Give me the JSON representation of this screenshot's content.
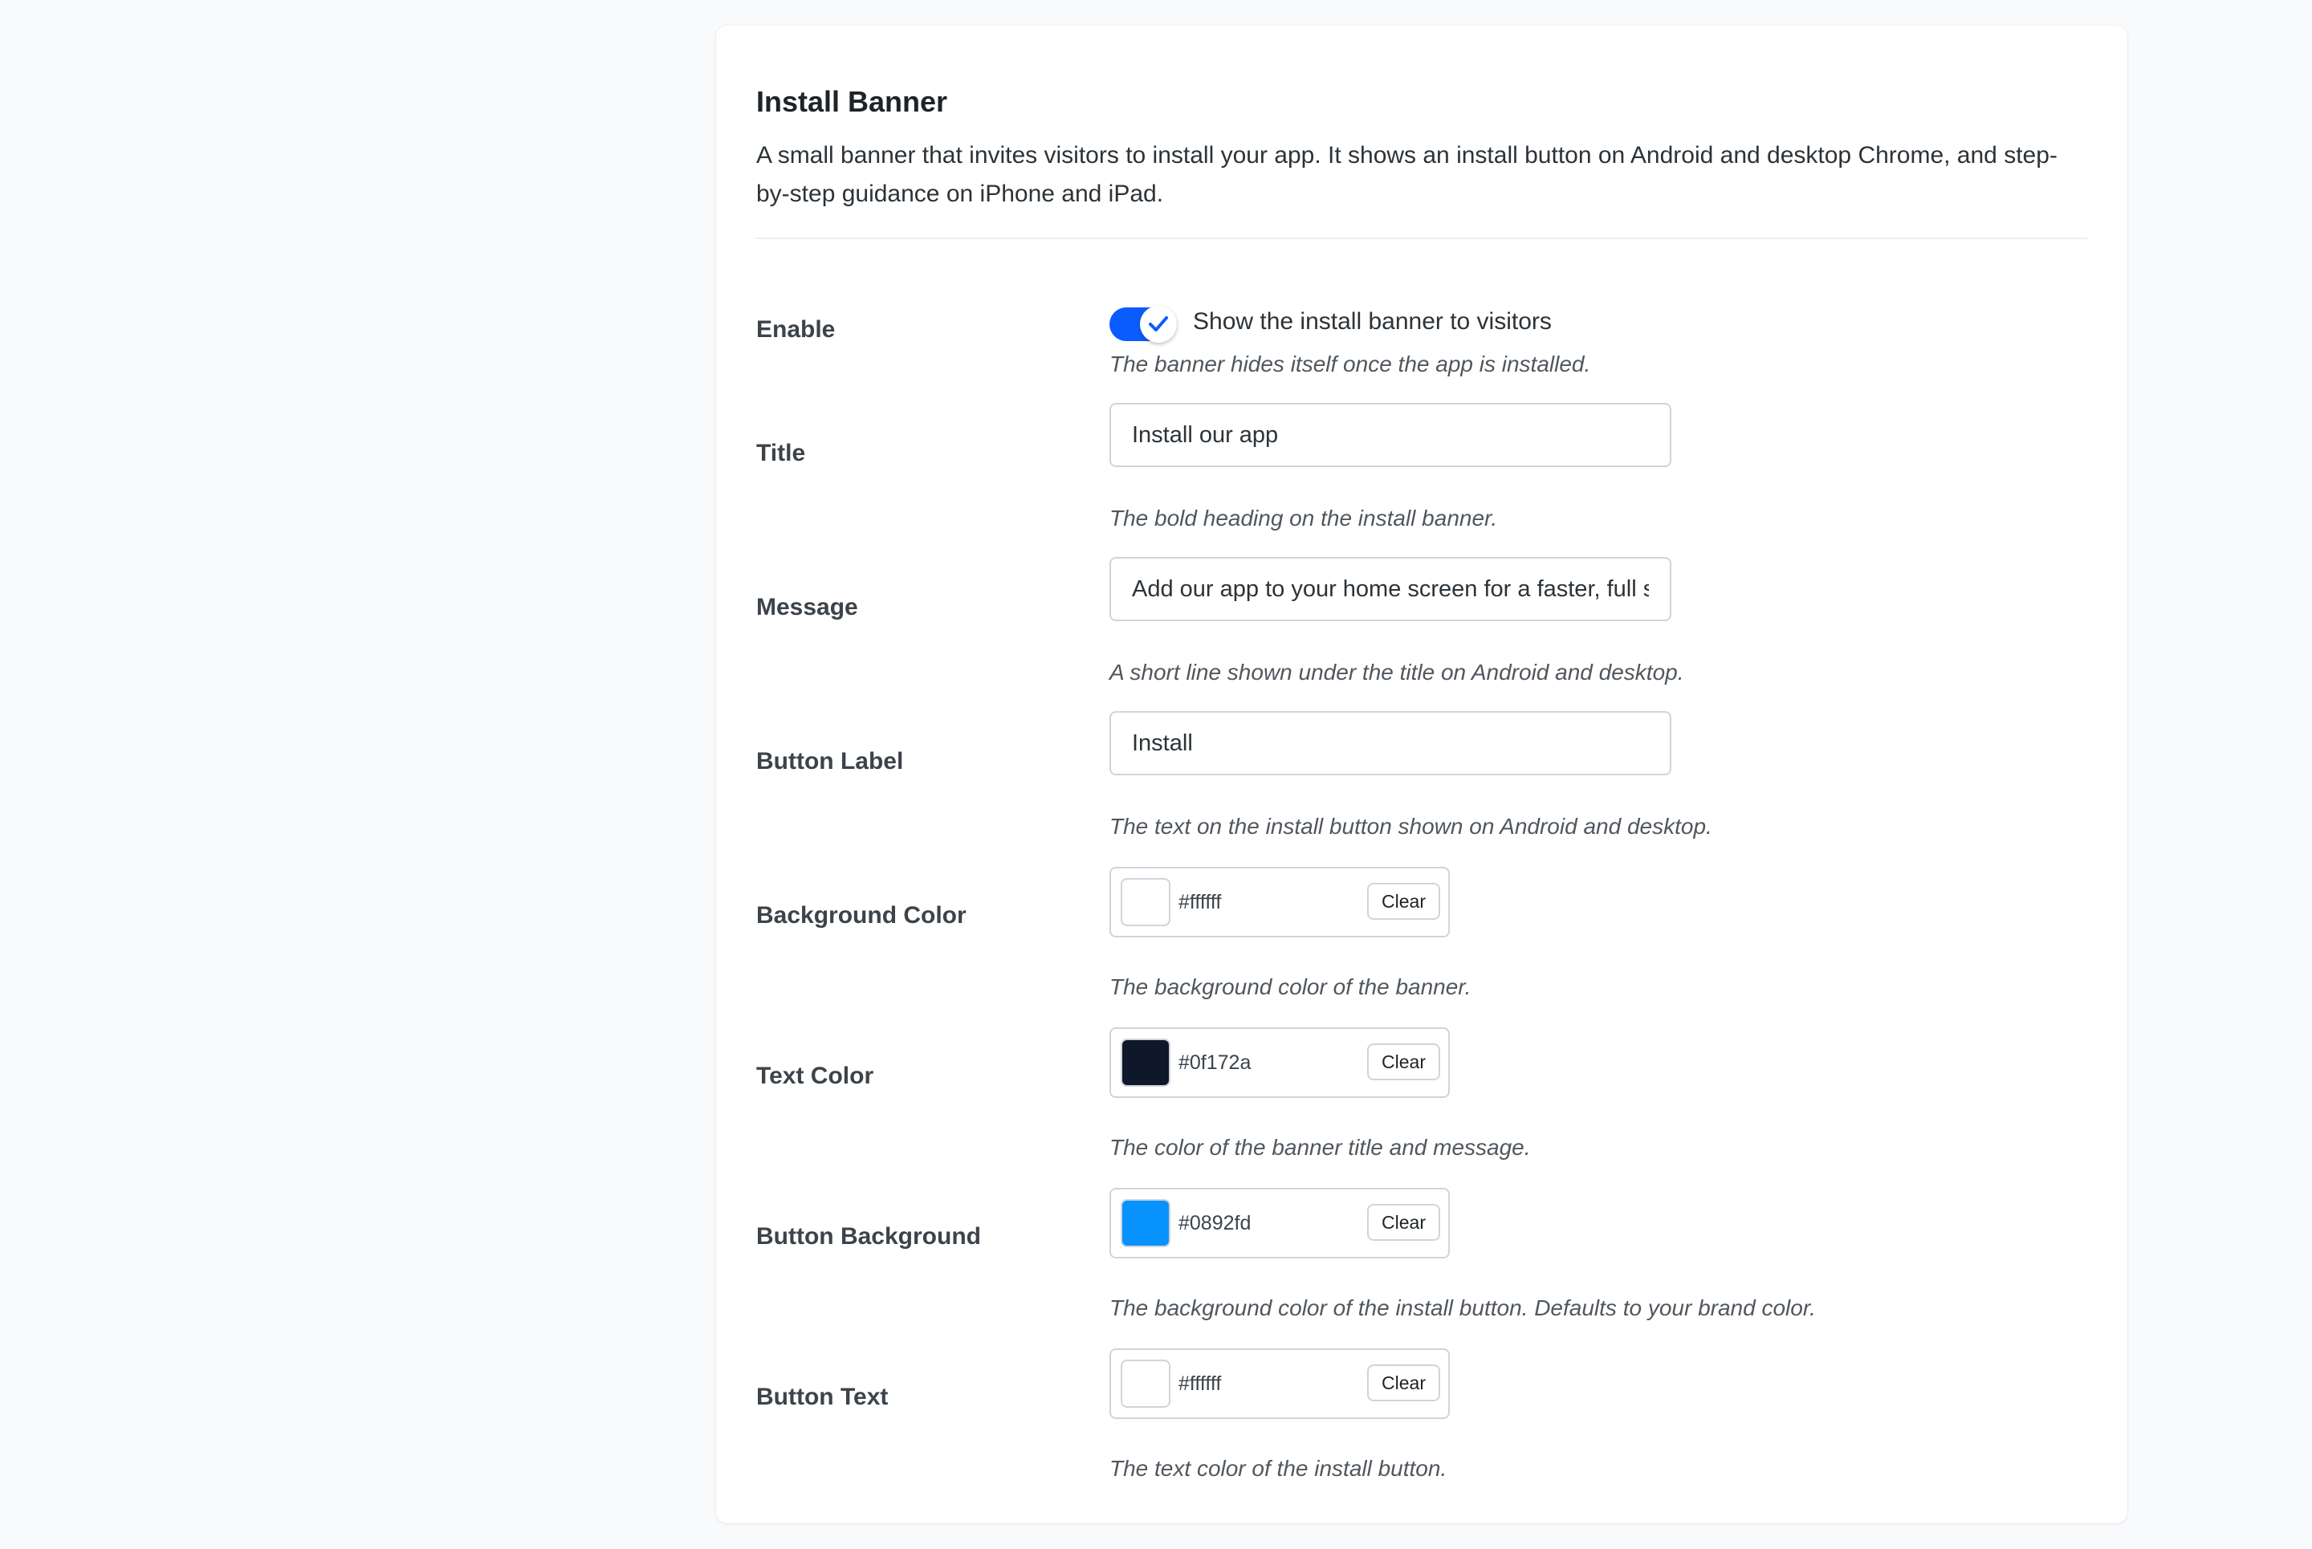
{
  "section": {
    "title": "Install Banner",
    "description": "A small banner that invites visitors to install your app. It shows an install button on Android and desktop Chrome, and step-by-step guidance on iPhone and iPad."
  },
  "enable": {
    "label": "Enable",
    "checked": true,
    "toggle_label": "Show the install banner to visitors",
    "help": "The banner hides itself once the app is installed."
  },
  "title_field": {
    "label": "Title",
    "value": "Install our app",
    "help": "The bold heading on the install banner."
  },
  "message_field": {
    "label": "Message",
    "value": "Add our app to your home screen for a faster, full s",
    "help": "A short line shown under the title on Android and desktop."
  },
  "button_label_field": {
    "label": "Button Label",
    "value": "Install",
    "help": "The text on the install button shown on Android and desktop."
  },
  "background_color": {
    "label": "Background Color",
    "value": "#ffffff",
    "clear_label": "Clear",
    "help": "The background color of the banner."
  },
  "text_color": {
    "label": "Text Color",
    "value": "#0f172a",
    "clear_label": "Clear",
    "help": "The color of the banner title and message."
  },
  "button_background": {
    "label": "Button Background",
    "value": "#0892fd",
    "clear_label": "Clear",
    "help": "The background color of the install button. Defaults to your brand color."
  },
  "button_text": {
    "label": "Button Text",
    "value": "#ffffff",
    "clear_label": "Clear",
    "help": "The text color of the install button."
  },
  "colors": {
    "toggle_on": "#0b5cff",
    "checkmark": "#0b5cff"
  },
  "icons": {
    "toggle_knob": "checkmark-icon"
  }
}
